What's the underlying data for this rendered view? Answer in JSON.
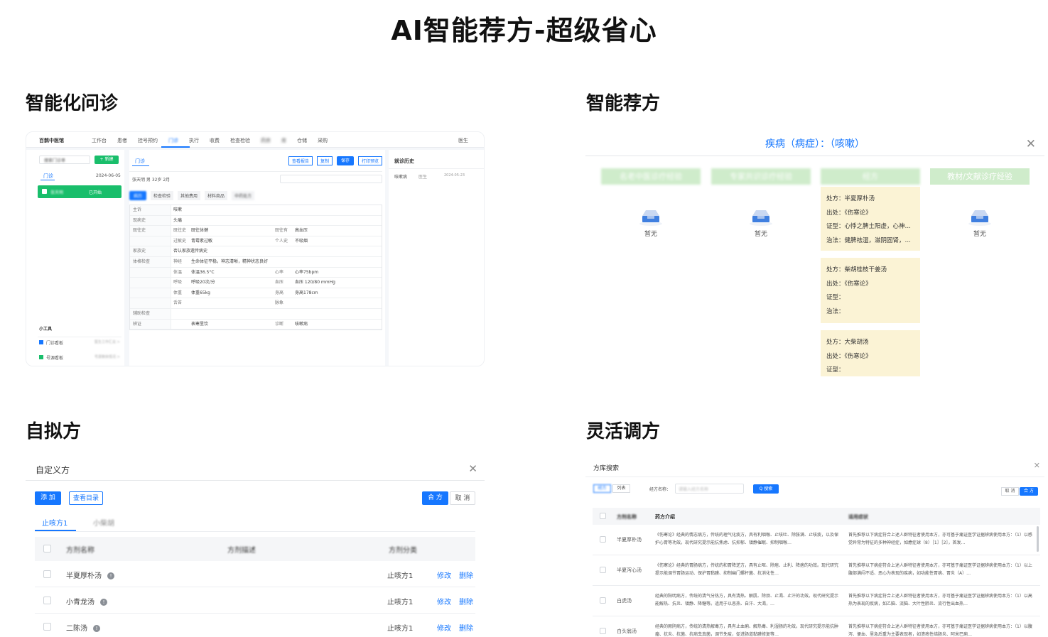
{
  "page_title": "AI智能荐方-超级省心",
  "sections": {
    "s1": "智能化问诊",
    "s2": "智能荐方",
    "s3": "自拟方",
    "s4": "灵活调方"
  },
  "p1": {
    "brand": "百鹊中医馆",
    "nav": [
      "工作台",
      "患者",
      "挂号预约",
      "门诊",
      "执行",
      "收费",
      "检查检验",
      "药房",
      "库",
      "仓储",
      "采购"
    ],
    "user": "医生",
    "search_placeholder": "搜索门诊单",
    "new_btn": "+ 新建",
    "left_tab": "门诊",
    "date": "2024-06-05",
    "patient": "张天明",
    "patient_status": "已开始",
    "tools_title": "小工具",
    "tool1": "门诊看板",
    "tool1_sub": "医生工作汇总 >",
    "tool2": "号源看板",
    "tool2_sub": "号源剩余情况 >",
    "tab_main": "门诊",
    "actions": [
      "查看报告",
      "复制",
      "保存",
      "打印预览"
    ],
    "patient_line": "张天明 男 32岁 2月",
    "sub_tabs": [
      "病历",
      "检查检验",
      "其他费用",
      "材料商品",
      "中药处方"
    ],
    "rows": [
      {
        "k": "主诉",
        "v": "咳嗽"
      },
      {
        "k": "现病史",
        "v": "头痛"
      },
      {
        "k": "既往史",
        "a": "既往史",
        "b": "既往体健",
        "c": "既往有",
        "d": "高血压"
      },
      {
        "k": "",
        "a": "过敏史",
        "b": "青霉素过敏",
        "c": "个人史",
        "d": "不吸烟"
      },
      {
        "k": "家族史",
        "v": "否认家族遗传病史"
      },
      {
        "k": "体格检查",
        "a": "神经",
        "b": "生命体征平稳，神志清晰，精神状态良好",
        "c": "",
        "d": ""
      },
      {
        "k": "",
        "a": "体温",
        "b": "体温36.5°C",
        "c": "心率",
        "d": "心率75bpm"
      },
      {
        "k": "",
        "a": "呼吸",
        "b": "呼吸20次/分",
        "c": "血压",
        "d": "血压 120/80 mmHg"
      },
      {
        "k": "",
        "a": "体重",
        "b": "体重65kg",
        "c": "身高",
        "d": "身高178cm"
      },
      {
        "k": "",
        "a": "舌苔",
        "b": "",
        "c": "脉象",
        "d": ""
      },
      {
        "k": "辅助检查",
        "v": ""
      },
      {
        "k": "辨证",
        "a": "",
        "b": "表寒里饮",
        "c": "诊断",
        "d": "咳嗽病"
      }
    ],
    "history_title": "就诊历史",
    "history_item": "咳嗽病",
    "history_doc": "医生",
    "history_date": "2024-05-23"
  },
  "p2": {
    "header": "疾病（病症）：（咳嗽）",
    "columns": [
      "名老中医诊疗经验",
      "专家共识诊疗经验",
      "经方",
      "教材/文献诊疗经验"
    ],
    "empty": "暂无",
    "cards": [
      {
        "lines": [
          "处方：半夏厚朴汤",
          "出处：《伤寒论》",
          "证型：心悸之脾土阳虚，心神…",
          "治法：健脾祛湿，滋阴固肾，…"
        ]
      },
      {
        "lines": [
          "处方：柴胡桂枝干姜汤",
          "出处：《伤寒论》",
          "证型：",
          "治法："
        ]
      },
      {
        "lines": [
          "处方：大柴胡汤",
          "出处：《伤寒论》",
          "证型："
        ]
      }
    ]
  },
  "p3": {
    "title": "自定义方",
    "btn_add": "添 加",
    "btn_catalog": "查看目录",
    "btn_merge": "合 方",
    "btn_cancel": "取 消",
    "tab1": "止咳方1",
    "tab2": "小柴胡",
    "col_name": "方剂名称",
    "col_desc": "方剂描述",
    "col_cat": "方剂分类",
    "rows": [
      {
        "name": "半夏厚朴汤",
        "cat": "止咳方1",
        "edit": "修改",
        "del": "删除"
      },
      {
        "name": "小青龙汤",
        "cat": "止咳方1",
        "edit": "修改",
        "del": "删除"
      },
      {
        "name": "二陈汤",
        "cat": "止咳方1",
        "edit": "修改",
        "del": "删除"
      }
    ]
  },
  "p4": {
    "title": "方库搜索",
    "tab1": "经方",
    "tab2": "列表",
    "label": "经方名称：",
    "placeholder": "请输入经方名称",
    "search_btn": "Q 搜索",
    "btn_cancel": "取 消",
    "btn_merge": "合 方",
    "col_name": "方剂名称",
    "col_intro": "药方介绍",
    "col_use": "适用症状",
    "rows": [
      {
        "name": "半夏厚朴汤",
        "intro": "《伤寒论》经典的情志病方，传统的理气化痰方，具有利咽喉、止咳吐、除胀满、止咳痰，以及保护心胃等功效。现代研究提示能抗焦虑、抗抑郁、镇静催眠、抑制咽喉…",
        "use": "首先推荐以下病症符合上述人群特征者使用本方，亦可基于痛证医学证据辨病使用本方：（1）以感觉异常为特征的多种神经症，如癔症球（8）［1］［2］，首发…"
      },
      {
        "name": "半夏泻心汤",
        "intro": "《伤寒论》经典的胃肠病方，传统的和胃降逆方，具有止呕、除痞、止利、降痞的功效。现代研究提示能调节胃肠运动、保护胃黏膜、抑制幽门螺杆菌、抗消化性…",
        "use": "首先推荐以下病症符合上述人群特征者使用本方，亦可基于痛证医学证据辨病使用本方：（1）以上腹部满闷不适、恶心为表现的疾病，如功能性胃病、胃炎（A）…"
      },
      {
        "name": "白虎汤",
        "intro": "经典的阳明病方，传统的清气分热方，具有清热、解肌、除烦、止渴、止汗的功效。现代研究提示能解热、抗炎、镇静、降糖等。适用于以恶热、自汗、大渴，…",
        "use": "首先推荐以下病症符合上述人群特征者使用本方，亦可基于痛证医学证据辨病使用本方：（1）以高热为表现的疾病，如乙脑、流脑、大叶性肺炎、流行性出血热…"
      },
      {
        "name": "白头翁汤",
        "intro": "经典的厥阴病方，传统的清热解毒方，具有止血痢、解热毒、利湿肠的功效。现代研究提示能抗肿瘤、抗炎、抗菌、抗病虫真菌，调节免疫，促进肠道黏膜修复等…",
        "use": "首先推荐以下病症符合上述人群特征者使用本方，亦可基于痛证医学证据辨病使用本方：（1）以腹泻、便血、里急后重为主要表现者，如溃疡性结肠炎、阿米巴痢…"
      }
    ]
  }
}
